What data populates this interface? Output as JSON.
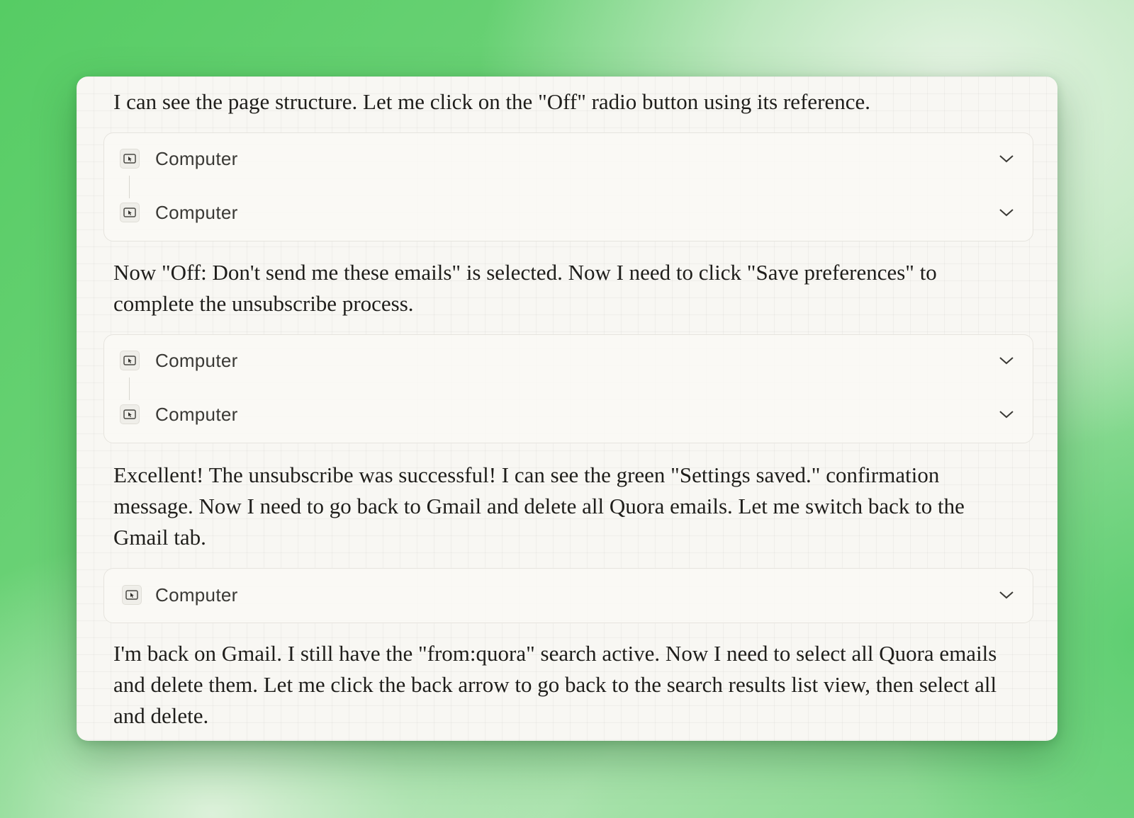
{
  "messages": [
    "I can see the page structure. Let me click on the \"Off\" radio button using its reference.",
    "Now \"Off: Don't send me these emails\" is selected. Now I need to click \"Save preferences\" to complete the unsubscribe process.",
    "Excellent! The unsubscribe was successful! I can see the green \"Settings saved.\" confirmation message. Now I need to go back to Gmail and delete all Quora emails. Let me switch back to the Gmail tab.",
    "I'm back on Gmail. I still have the \"from:quora\" search active. Now I need to select all Quora emails and delete them. Let me click the back arrow to go back to the search results list view, then select all and delete."
  ],
  "tool_groups": [
    {
      "calls": [
        {
          "label": "Computer",
          "icon": "computer-cursor-icon"
        },
        {
          "label": "Computer",
          "icon": "computer-cursor-icon"
        }
      ]
    },
    {
      "calls": [
        {
          "label": "Computer",
          "icon": "computer-cursor-icon"
        },
        {
          "label": "Computer",
          "icon": "computer-cursor-icon"
        }
      ]
    },
    {
      "calls": [
        {
          "label": "Computer",
          "icon": "computer-cursor-icon"
        }
      ]
    }
  ],
  "expand_icon": "chevron-down-icon"
}
